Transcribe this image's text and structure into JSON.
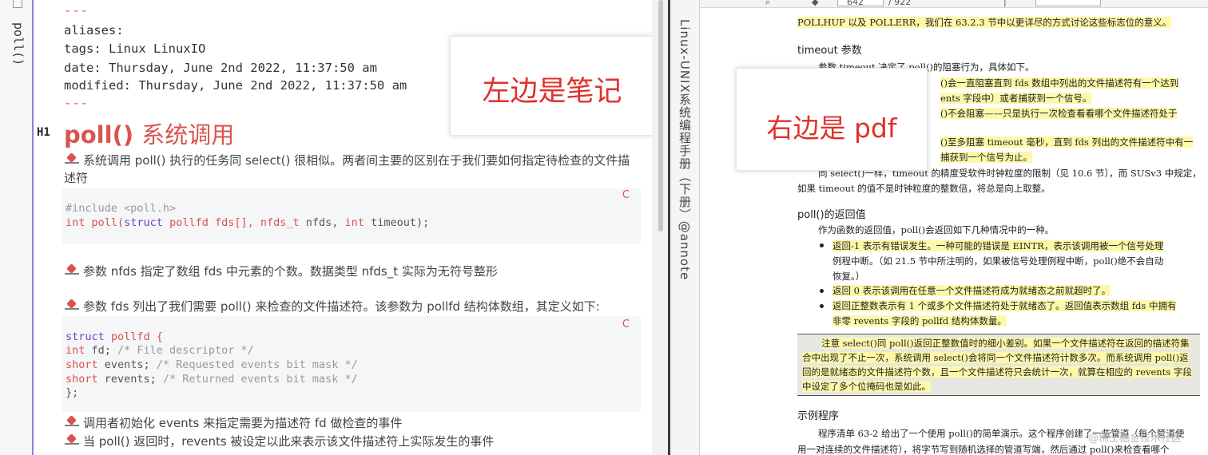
{
  "left_sidebar": {
    "tab_label": "poll()"
  },
  "note": {
    "frontmatter": {
      "dash_top": "---",
      "aliases": "aliases:",
      "tags": "tags: Linux LinuxIO",
      "date": "date: Thursday, June 2nd 2022, 11:37:50 am",
      "modified": "modified: Thursday, June 2nd 2022, 11:37:50 am",
      "dash_bottom": "---"
    },
    "heading_badge": "H1",
    "heading_code": "poll()",
    "heading_text": "系统调用",
    "para1": "系统调用 poll() 执行的任务同 select() 很相似。两者间主要的区别在于我们要如何指定待检查的文件描述符",
    "code1": {
      "lang": "C",
      "line1": "#include <poll.h>",
      "line2_a": "int",
      "line2_b": " poll(",
      "line2_c": "struct",
      "line2_d": " pollfd fds[], ",
      "line2_e": "nfds_t",
      "line2_f": " nfds, ",
      "line2_g": "int",
      "line2_h": " timeout);"
    },
    "para2": "参数 nfds 指定了数组 fds 中元素的个数。数据类型 nfds_t 实际为无符号整形",
    "para3": "参数 fds 列出了我们需要 poll() 来检查的文件描述符。该参数为 pollfd 结构体数组，其定义如下:",
    "code2": {
      "lang": "C",
      "l1a": "struct",
      "l1b": " pollfd {",
      "l2a": "int",
      "l2b": " fd; ",
      "l2c": "/* File descriptor */",
      "l3a": "short",
      "l3b": " events; ",
      "l3c": "/* Requested events bit mask */",
      "l4a": "short",
      "l4b": " revents; ",
      "l4c": "/* Returned events bit mask */",
      "l5": "};"
    },
    "para4": "调用者初始化 events 来指定需要为描述符 fd 做检查的事件",
    "para5": "当 poll() 返回时，revents 被设定以此来表示该文件描述符上实际发生的事件",
    "callout": "左边是笔记"
  },
  "pdf": {
    "side_title": "Linux-UNIX系统编程手册（下册）@annote",
    "toolbar": {
      "page_num": "642",
      "page_total": "/ 922"
    },
    "lines": {
      "l0": "POLLHUP 以及 POLLERR，我们在 63.2.3 节中以更详尽的方式讨论这些标志位的意义。",
      "h_timeout": "timeout 参数",
      "l1": "参数 timeout 决定了 poll()的阻塞行为，具体如下。",
      "l2": "()会一直阻塞直到 fds 数组中列出的文件描述符有一个达到",
      "l3": "ents 字段中）或者捕获到一个信号。",
      "l4": "()不会阻塞——只是执行一次检查看看哪个文件描述符处于",
      "l5": "()至多阻塞 timeout 毫秒，直到 fds 列出的文件描述符中有一",
      "l6": "捕获到一个信号为止。",
      "l7": "同 select()一样，timeout 的精度受软件时钟粒度的限制（见 10.6 节），而 SUSv3 中规定，",
      "l8": "如果 timeout 的值不是时钟粒度的整数倍，将总是向上取整。",
      "h_return": "poll()的返回值",
      "l9": "作为函数的返回值，poll()会返回如下几种情况中的一种。",
      "b1a": "返回-1 表示有错误发生。一种可能的错误是 EINTR，表示该调用被一个信号处理",
      "b1b": "例程中断。（如 21.5 节中所注明的，如果被信号处理例程中断，poll()绝不会自动",
      "b1c": "恢复。）",
      "b2": "返回 0 表示该调用在任意一个文件描述符成为就绪态之前就超时了。",
      "b3a": "返回正整数表示有 1 个或多个文件描述符处于就绪态了。返回值表示数组 fds 中拥有",
      "b3b": "非零 revents 字段的 pollfd 结构体数量。",
      "n1": "注意 select()同 poll()返回正整数值时的细小差别。如果一个文件描述符在返回的描述符集",
      "n2": "合中出现了不止一次，系统调用 select()会将同一个文件描述符计数多次。而系统调用 poll()返",
      "n3": "回的是就绪态的文件描述符个数，且一个文件描述符只会统计一次，就算在相应的 revents 字段",
      "n4": "中设定了多个位掩码也是如此。",
      "h_example": "示例程序",
      "l10": "程序清单 63-2 给出了一个使用 poll()的简单演示。这个程序创建了一些管道（每个管道使",
      "l11": "用一对连续的文件描述符），将字节写到随机选择的管道写端，然后通过 poll()来检查看哪个"
    },
    "callout": "右边是 pdf",
    "watermark": "@稀土掘金技术社区"
  }
}
